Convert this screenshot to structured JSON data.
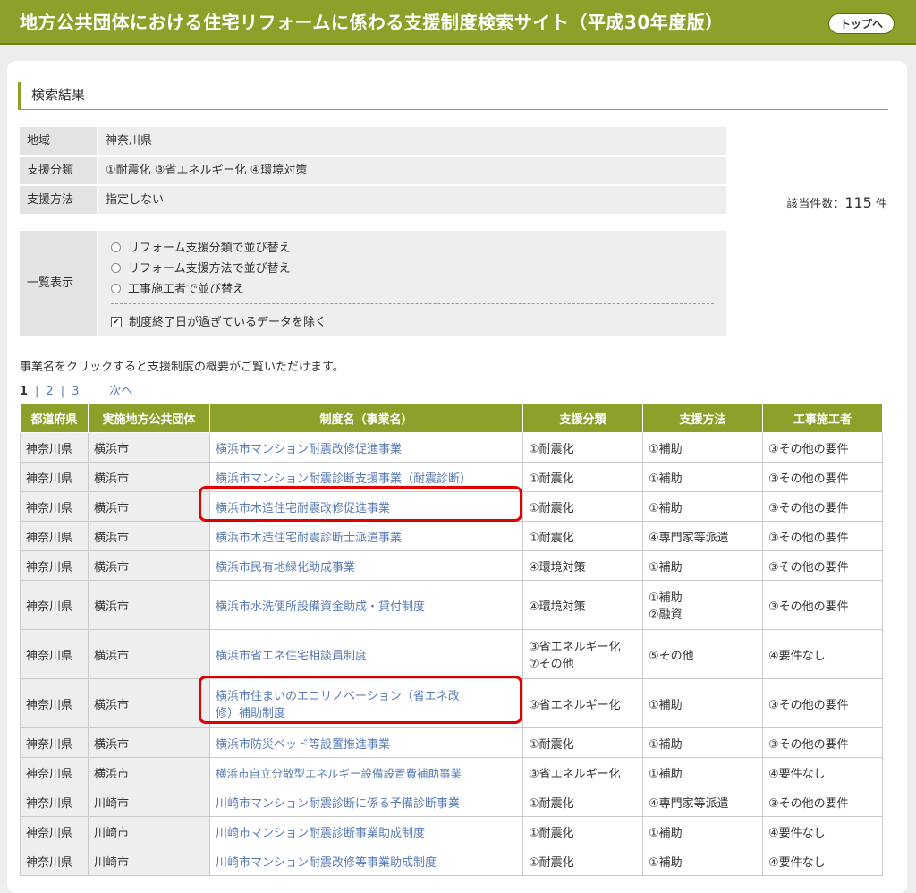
{
  "header": {
    "title": "地方公共団体における住宅リフォームに係わる支援制度検索サイト（平成30年度版）",
    "top_button": "トップへ"
  },
  "section_title": "検索結果",
  "conditions": [
    {
      "label": "地域",
      "value": "神奈川県"
    },
    {
      "label": "支援分類",
      "value": "①耐震化 ③省エネルギー化 ④環境対策"
    },
    {
      "label": "支援方法",
      "value": "指定しない"
    }
  ],
  "count": {
    "prefix": "該当件数：",
    "value": "115",
    "suffix": " 件"
  },
  "view_options": {
    "label": "一覧表示",
    "sort_options": [
      "リフォーム支援分類で並び替え",
      "リフォーム支援方法で並び替え",
      "工事施工者で並び替え"
    ],
    "exclude_label": "制度終了日が過ぎているデータを除く",
    "exclude_checked": true
  },
  "hint": "事業名をクリックすると支援制度の概要がご覧いただけます。",
  "pager": {
    "current": "1",
    "pages": [
      "2",
      "3"
    ],
    "next": "次へ"
  },
  "table": {
    "headers": [
      "都道府県",
      "実施地方公共団体",
      "制度名（事業名）",
      "支援分類",
      "支援方法",
      "工事施工者"
    ],
    "rows": [
      {
        "pref": "神奈川県",
        "city": "横浜市",
        "name": "横浜市マンション耐震改修促進事業",
        "kind": "①耐震化",
        "how": "①補助",
        "who": "③その他の要件"
      },
      {
        "pref": "神奈川県",
        "city": "横浜市",
        "name": "横浜市マンション耐震診断支援事業（耐震診断）",
        "kind": "①耐震化",
        "how": "①補助",
        "who": "③その他の要件"
      },
      {
        "pref": "神奈川県",
        "city": "横浜市",
        "name": "横浜市木造住宅耐震改修促進事業",
        "kind": "①耐震化",
        "how": "①補助",
        "who": "③その他の要件"
      },
      {
        "pref": "神奈川県",
        "city": "横浜市",
        "name": "横浜市木造住宅耐震診断士派遣事業",
        "kind": "①耐震化",
        "how": "④専門家等派遣",
        "who": "③その他の要件"
      },
      {
        "pref": "神奈川県",
        "city": "横浜市",
        "name": "横浜市民有地緑化助成事業",
        "kind": "④環境対策",
        "how": "①補助",
        "who": "③その他の要件"
      },
      {
        "pref": "神奈川県",
        "city": "横浜市",
        "name": "横浜市水洗便所設備資金助成・貸付制度",
        "kind": "④環境対策",
        "how": "①補助",
        "how2": "②融資",
        "who": "③その他の要件"
      },
      {
        "pref": "神奈川県",
        "city": "横浜市",
        "name": "横浜市省エネ住宅相談員制度",
        "kind": "③省エネルギー化",
        "kind2": "⑦その他",
        "how": "⑤その他",
        "who": "④要件なし"
      },
      {
        "pref": "神奈川県",
        "city": "横浜市",
        "name": "横浜市住まいのエコリノベーション（省エネ改",
        "name2": "修）補助制度",
        "kind": "③省エネルギー化",
        "how": "①補助",
        "who": "③その他の要件"
      },
      {
        "pref": "神奈川県",
        "city": "横浜市",
        "name": "横浜市防災ベッド等設置推進事業",
        "kind": "①耐震化",
        "how": "①補助",
        "who": "③その他の要件"
      },
      {
        "pref": "神奈川県",
        "city": "横浜市",
        "name": "横浜市自立分散型エネルギー設備設置費補助事業",
        "kind": "③省エネルギー化",
        "how": "①補助",
        "who": "④要件なし"
      },
      {
        "pref": "神奈川県",
        "city": "川崎市",
        "name": "川崎市マンション耐震診断に係る予備診断事業",
        "kind": "①耐震化",
        "how": "④専門家等派遣",
        "who": "③その他の要件"
      },
      {
        "pref": "神奈川県",
        "city": "川崎市",
        "name": "川崎市マンション耐震診断事業助成制度",
        "kind": "①耐震化",
        "how": "①補助",
        "who": "④要件なし"
      },
      {
        "pref": "神奈川県",
        "city": "川崎市",
        "name": "川崎市マンション耐震改修等事業助成制度",
        "kind": "①耐震化",
        "how": "①補助",
        "who": "④要件なし"
      }
    ]
  }
}
